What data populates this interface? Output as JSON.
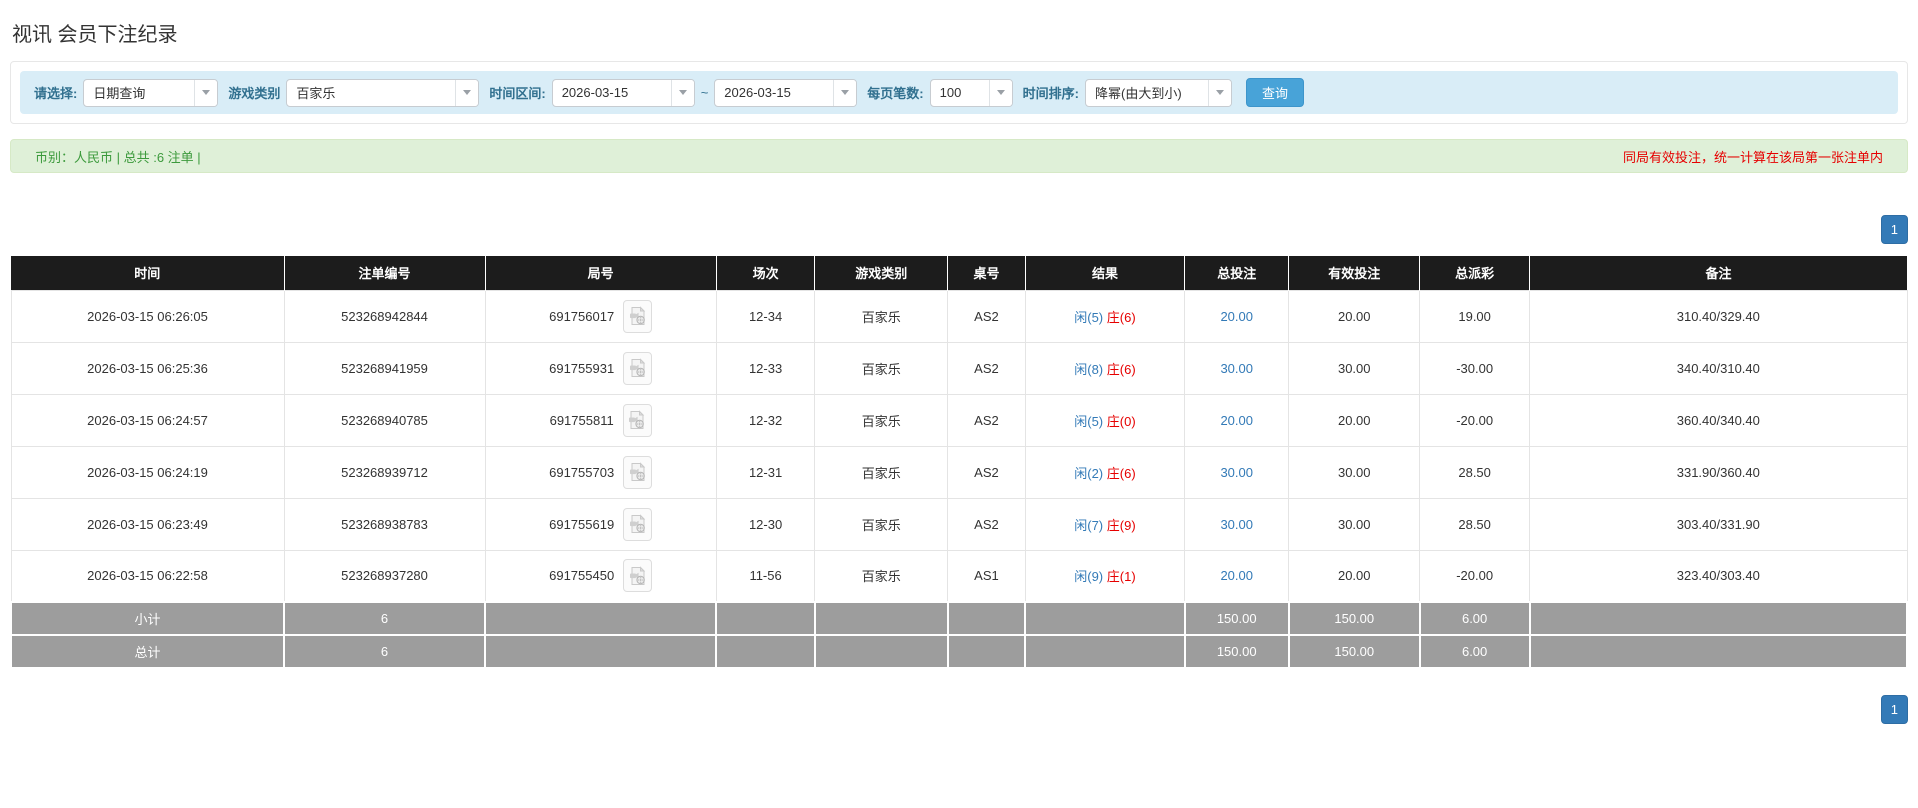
{
  "page": {
    "title": "视讯 会员下注纪录"
  },
  "filters": {
    "select_label": "请选择:",
    "select_value": "日期查询",
    "game_label": "游戏类别",
    "game_value": "百家乐",
    "range_label": "时间区间:",
    "date_from": "2026-03-15",
    "range_separator": "~",
    "date_to": "2026-03-15",
    "per_page_label": "每页笔数:",
    "per_page_value": "100",
    "sort_label": "时间排序:",
    "sort_value": "降幂(由大到小)",
    "search_button": "查询"
  },
  "summary": {
    "left_text": "币别：人民币 | 总共 :6 注单 |",
    "right_text": "同局有效投注，统一计算在该局第一张注单内",
    "left_color": "#3c9a3c",
    "right_color": "#e60000",
    "background": "#dff0d8"
  },
  "pagination": {
    "page": "1",
    "button_color": "#337ab7"
  },
  "colors": {
    "header_bg": "#1c1c1c",
    "link_blue": "#337ab7",
    "negative_red": "#e60000",
    "footer_gray": "#9d9d9d",
    "filter_bar_bg": "#d9edf7",
    "search_button_bg": "#48a3d8"
  },
  "table": {
    "headers": [
      "时间",
      "注单编号",
      "局号",
      "场次",
      "游戏类别",
      "桌号",
      "结果",
      "总投注",
      "有效投注",
      "总派彩",
      "备注"
    ],
    "rows": [
      {
        "time": "2026-03-15 06:26:05",
        "bet_id": "523268942844",
        "round_id": "691756017",
        "session": "12-34",
        "game": "百家乐",
        "table_id": "AS2",
        "result_player": "闲(5)",
        "result_banker": "庄(6)",
        "total_bet": "20.00",
        "valid_bet": "20.00",
        "payout": "19.00",
        "remark": "310.40/329.40"
      },
      {
        "time": "2026-03-15 06:25:36",
        "bet_id": "523268941959",
        "round_id": "691755931",
        "session": "12-33",
        "game": "百家乐",
        "table_id": "AS2",
        "result_player": "闲(8)",
        "result_banker": "庄(6)",
        "total_bet": "30.00",
        "valid_bet": "30.00",
        "payout": "-30.00",
        "remark": "340.40/310.40"
      },
      {
        "time": "2026-03-15 06:24:57",
        "bet_id": "523268940785",
        "round_id": "691755811",
        "session": "12-32",
        "game": "百家乐",
        "table_id": "AS2",
        "result_player": "闲(5)",
        "result_banker": "庄(0)",
        "total_bet": "20.00",
        "valid_bet": "20.00",
        "payout": "-20.00",
        "remark": "360.40/340.40"
      },
      {
        "time": "2026-03-15 06:24:19",
        "bet_id": "523268939712",
        "round_id": "691755703",
        "session": "12-31",
        "game": "百家乐",
        "table_id": "AS2",
        "result_player": "闲(2)",
        "result_banker": "庄(6)",
        "total_bet": "30.00",
        "valid_bet": "30.00",
        "payout": "28.50",
        "remark": "331.90/360.40"
      },
      {
        "time": "2026-03-15 06:23:49",
        "bet_id": "523268938783",
        "round_id": "691755619",
        "session": "12-30",
        "game": "百家乐",
        "table_id": "AS2",
        "result_player": "闲(7)",
        "result_banker": "庄(9)",
        "total_bet": "30.00",
        "valid_bet": "30.00",
        "payout": "28.50",
        "remark": "303.40/331.90"
      },
      {
        "time": "2026-03-15 06:22:58",
        "bet_id": "523268937280",
        "round_id": "691755450",
        "session": "11-56",
        "game": "百家乐",
        "table_id": "AS1",
        "result_player": "闲(9)",
        "result_banker": "庄(1)",
        "total_bet": "20.00",
        "valid_bet": "20.00",
        "payout": "-20.00",
        "remark": "323.40/303.40"
      }
    ],
    "footer": [
      {
        "label": "小计",
        "count": "6",
        "total_bet": "150.00",
        "valid_bet": "150.00",
        "payout": "6.00"
      },
      {
        "label": "总计",
        "count": "6",
        "total_bet": "150.00",
        "valid_bet": "150.00",
        "payout": "6.00"
      }
    ]
  }
}
